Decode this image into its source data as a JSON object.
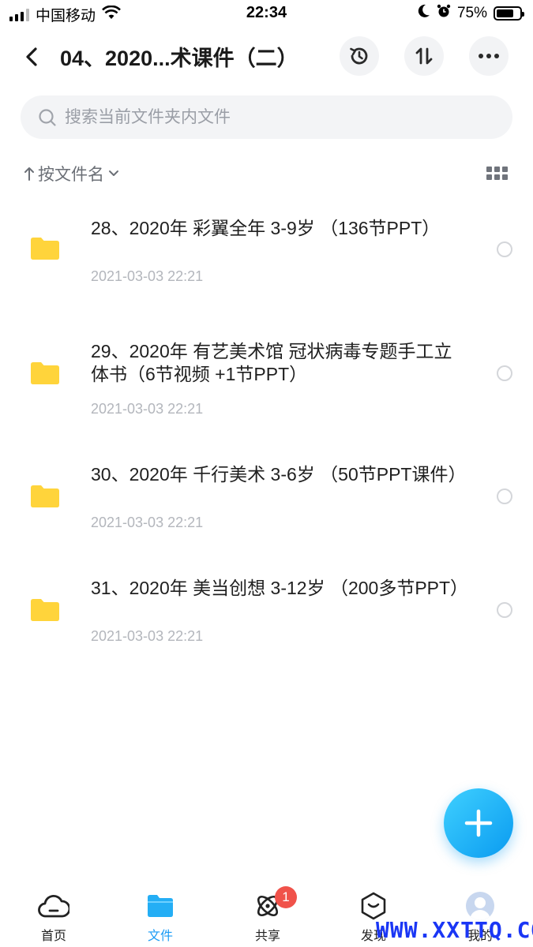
{
  "status_bar": {
    "carrier": "中国移动",
    "time": "22:34",
    "battery": "75%",
    "battery_level": 0.75
  },
  "header": {
    "title": "04、2020...术课件（二）"
  },
  "search": {
    "placeholder": "搜索当前文件夹内文件"
  },
  "sort": {
    "label": "按文件名"
  },
  "files": [
    {
      "name": "28、2020年  彩翼全年   3-9岁    （136节PPT）",
      "date": "2021-03-03 22:21"
    },
    {
      "name": "29、2020年  有艺美术馆   冠状病毒专题手工立体书（6节视频 +1节PPT）",
      "date": "2021-03-03 22:21"
    },
    {
      "name": "30、2020年  千行美术   3-6岁    （50节PPT课件）",
      "date": "2021-03-03 22:21"
    },
    {
      "name": "31、2020年  美当创想   3-12岁    （200多节PPT）",
      "date": "2021-03-03 22:21"
    }
  ],
  "tabs": [
    {
      "label": "首页"
    },
    {
      "label": "文件"
    },
    {
      "label": "共享",
      "badge": "1"
    },
    {
      "label": "发现"
    },
    {
      "label": "我的"
    }
  ],
  "watermark": "WWW.XXTTQ.COM",
  "colors": {
    "accent": "#1a9bf5",
    "folder": "#ffd43b",
    "badge": "#f0524a",
    "watermark": "#1a36f5"
  }
}
